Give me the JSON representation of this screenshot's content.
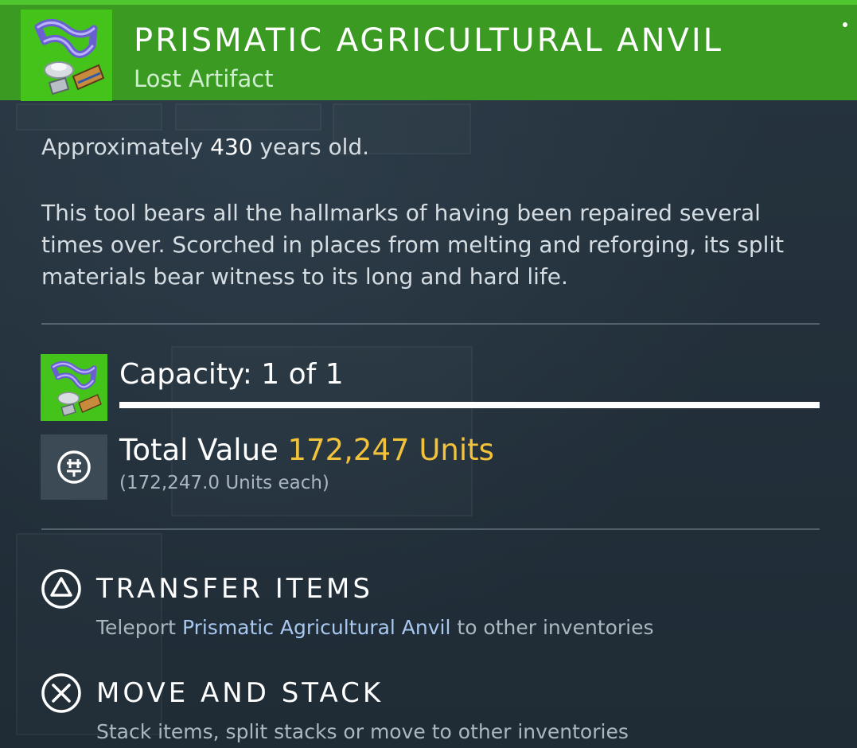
{
  "item": {
    "name": "PRISMATIC AGRICULTURAL ANVIL",
    "category": "Lost Artifact",
    "icon": "prismatic-anvil-artifact-icon",
    "rarity_color": "#3a9a22",
    "icon_bg_color": "#44c41a"
  },
  "description": {
    "age_prefix": "Approximately",
    "age_value": "430",
    "age_suffix": "years old.",
    "lore": "This tool bears all the hallmarks of having been repaired several times over. Scorched in places from melting and reforging, its split materials bear witness to its long and hard life."
  },
  "capacity": {
    "label": "Capacity: 1 of 1",
    "current": 1,
    "max": 1
  },
  "value": {
    "label": "Total Value",
    "amount": "172,247 Units",
    "each": "(172,247.0 Units each)",
    "icon": "units-currency-icon",
    "accent_color": "#f2c23a"
  },
  "actions": [
    {
      "button_icon": "triangle-button-icon",
      "title": "TRANSFER ITEMS",
      "desc_prefix": "Teleport",
      "desc_highlight": "Prismatic Agricultural Anvil",
      "desc_suffix": "to other inventories"
    },
    {
      "button_icon": "cross-button-icon",
      "title": "MOVE AND STACK",
      "desc": "Stack items, split stacks or move to other inventories"
    }
  ]
}
